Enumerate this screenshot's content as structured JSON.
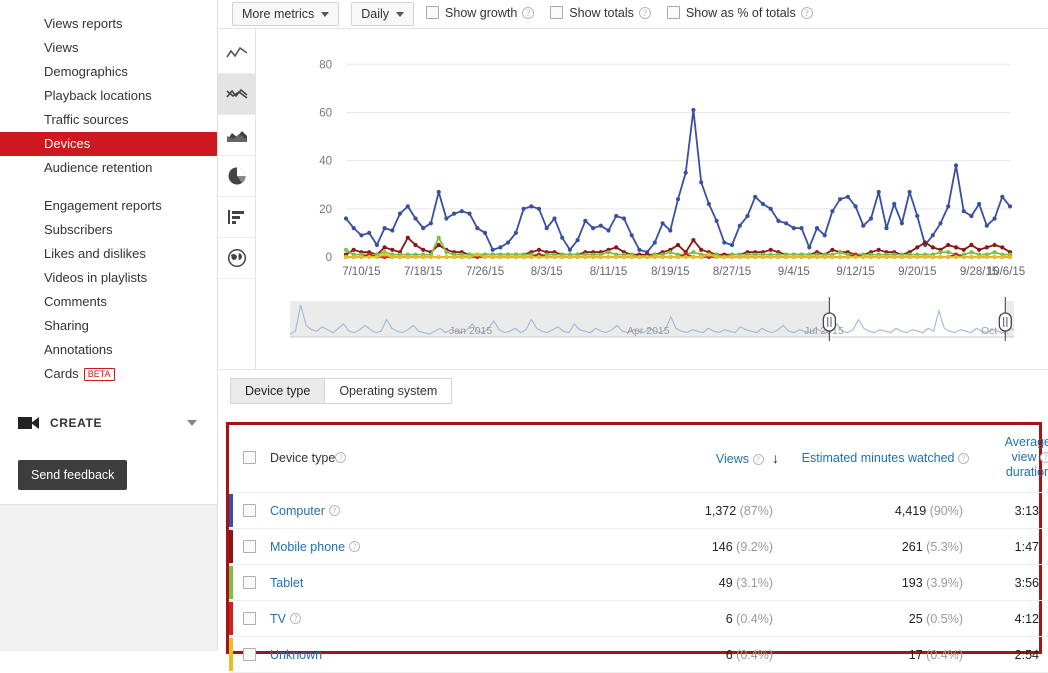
{
  "sidebar": {
    "items": [
      {
        "label": "Views reports",
        "active": false,
        "badge": null
      },
      {
        "label": "Views",
        "active": false,
        "badge": null
      },
      {
        "label": "Demographics",
        "active": false,
        "badge": null
      },
      {
        "label": "Playback locations",
        "active": false,
        "badge": null
      },
      {
        "label": "Traffic sources",
        "active": false,
        "badge": null
      },
      {
        "label": "Devices",
        "active": true,
        "badge": null
      },
      {
        "label": "Audience retention",
        "active": false,
        "badge": null
      },
      {
        "label": "Engagement reports",
        "active": false,
        "badge": null
      },
      {
        "label": "Subscribers",
        "active": false,
        "badge": null
      },
      {
        "label": "Likes and dislikes",
        "active": false,
        "badge": null
      },
      {
        "label": "Videos in playlists",
        "active": false,
        "badge": null
      },
      {
        "label": "Comments",
        "active": false,
        "badge": null
      },
      {
        "label": "Sharing",
        "active": false,
        "badge": null
      },
      {
        "label": "Annotations",
        "active": false,
        "badge": null
      },
      {
        "label": "Cards",
        "active": false,
        "badge": "BETA"
      }
    ],
    "gap_after_index": 6,
    "create_label": "CREATE",
    "create_icon": "video-camera-icon",
    "create_chevron_icon": "chevron-down-icon",
    "feedback_label": "Send feedback"
  },
  "toolbar": {
    "more_metrics_label": "More metrics",
    "period_label": "Daily",
    "checkboxes": [
      {
        "label": "Show growth",
        "checked": false
      },
      {
        "label": "Show totals",
        "checked": false
      },
      {
        "label": "Show as % of totals",
        "checked": false
      }
    ],
    "help_glyph": "?"
  },
  "chart_types": [
    {
      "name": "line-chart-icon",
      "active": false
    },
    {
      "name": "multi-line-chart-icon",
      "active": true
    },
    {
      "name": "area-chart-icon",
      "active": false
    },
    {
      "name": "pie-chart-icon",
      "active": false
    },
    {
      "name": "bar-chart-icon",
      "active": false
    },
    {
      "name": "geo-map-icon",
      "active": false
    }
  ],
  "range_selector": {
    "labels": [
      "Jan 2015",
      "Apr 2015",
      "Jul 2015",
      "Oct ..."
    ],
    "left_handle_pct": 74.5,
    "right_handle_pct": 98.8
  },
  "tabs": [
    {
      "label": "Device type",
      "active": true
    },
    {
      "label": "Operating system",
      "active": false
    }
  ],
  "table": {
    "headers": {
      "name": "Device type",
      "views": "Views",
      "minutes": "Estimated minutes watched",
      "avd_line1": "Average",
      "avd_line2": "view",
      "avd_line3": "duration"
    },
    "sort_arrow": "↓",
    "rows": [
      {
        "name": "Computer",
        "color": "#3a4fa0",
        "views": "1,372",
        "views_pct": "(87%)",
        "minutes": "4,419",
        "minutes_pct": "(90%)",
        "avd": "3:13",
        "has_help": true
      },
      {
        "name": "Mobile phone",
        "color": "#8c1616",
        "views": "146",
        "views_pct": "(9.2%)",
        "minutes": "261",
        "minutes_pct": "(5.3%)",
        "avd": "1:47",
        "has_help": true
      },
      {
        "name": "Tablet",
        "color": "#7cc043",
        "views": "49",
        "views_pct": "(3.1%)",
        "minutes": "193",
        "minutes_pct": "(3.9%)",
        "avd": "3:56",
        "has_help": false
      },
      {
        "name": "TV",
        "color": "#cc2222",
        "views": "6",
        "views_pct": "(0.4%)",
        "minutes": "25",
        "minutes_pct": "(0.5%)",
        "avd": "4:12",
        "has_help": true
      },
      {
        "name": "Unknown",
        "color": "#e8c020",
        "views": "6",
        "views_pct": "(0.4%)",
        "minutes": "17",
        "minutes_pct": "(0.4%)",
        "avd": "2:54",
        "has_help": false
      }
    ]
  },
  "chart_data": {
    "type": "line",
    "title": "",
    "xlabel": "",
    "ylabel": "",
    "ylim": [
      0,
      88
    ],
    "yticks": [
      0,
      20,
      40,
      60,
      80
    ],
    "grid": true,
    "legend_position": "none",
    "x_tick_labels": [
      "7/10/15",
      "7/18/15",
      "7/26/15",
      "8/3/15",
      "8/11/15",
      "8/19/15",
      "8/27/15",
      "9/4/15",
      "9/12/15",
      "9/20/15",
      "9/28/15",
      "10/6/15"
    ],
    "x_tick_step_days": 8,
    "x_start": "7/8/15",
    "x_end": "10/8/15",
    "series": [
      {
        "name": "Computer",
        "color": "#3a4fa0",
        "values": [
          16,
          12,
          9,
          10,
          5,
          12,
          11,
          18,
          21,
          16,
          12,
          14,
          27,
          16,
          18,
          19,
          18,
          12,
          10,
          3,
          4,
          6,
          10,
          20,
          21,
          20,
          12,
          16,
          8,
          3,
          7,
          15,
          12,
          13,
          11,
          17,
          16,
          9,
          3,
          2,
          6,
          14,
          11,
          24,
          35,
          61,
          31,
          22,
          15,
          6,
          5,
          13,
          17,
          25,
          22,
          20,
          15,
          14,
          12,
          12,
          4,
          12,
          9,
          19,
          24,
          25,
          21,
          13,
          16,
          27,
          12,
          22,
          14,
          27,
          17,
          5,
          9,
          14,
          21,
          38,
          19,
          17,
          22,
          13,
          16,
          25,
          21
        ]
      },
      {
        "name": "Mobile phone",
        "color": "#8c1616",
        "values": [
          1,
          3,
          2,
          2,
          1,
          4,
          3,
          2,
          8,
          5,
          3,
          2,
          5,
          3,
          2,
          2,
          1,
          1,
          1,
          1,
          1,
          1,
          1,
          1,
          2,
          3,
          2,
          2,
          1,
          1,
          1,
          2,
          2,
          2,
          3,
          4,
          2,
          1,
          1,
          1,
          1,
          2,
          3,
          5,
          2,
          7,
          3,
          2,
          1,
          1,
          1,
          1,
          2,
          2,
          2,
          3,
          2,
          1,
          1,
          1,
          1,
          2,
          1,
          3,
          2,
          2,
          1,
          1,
          2,
          3,
          2,
          2,
          1,
          2,
          4,
          6,
          4,
          3,
          5,
          4,
          3,
          5,
          3,
          4,
          5,
          4,
          2
        ]
      },
      {
        "name": "Tablet",
        "color": "#7cc043",
        "values": [
          3,
          1,
          1,
          1,
          1,
          2,
          1,
          1,
          1,
          1,
          1,
          1,
          8,
          2,
          1,
          1,
          1,
          1,
          1,
          1,
          1,
          1,
          1,
          1,
          1,
          1,
          1,
          1,
          1,
          1,
          1,
          1,
          1,
          1,
          2,
          1,
          1,
          1,
          0,
          0,
          1,
          1,
          2,
          1,
          1,
          2,
          1,
          1,
          1,
          0,
          1,
          1,
          1,
          1,
          1,
          1,
          1,
          1,
          1,
          1,
          1,
          1,
          1,
          1,
          2,
          1,
          1,
          1,
          1,
          1,
          1,
          1,
          1,
          1,
          1,
          1,
          1,
          2,
          2,
          1,
          1,
          2,
          1,
          1,
          2,
          1,
          1
        ]
      },
      {
        "name": "TV",
        "color": "#cc2222",
        "values": [
          0,
          0,
          0,
          1,
          0,
          0,
          0,
          0,
          0,
          0,
          0,
          0,
          0,
          0,
          0,
          0,
          0,
          0,
          0,
          0,
          0,
          0,
          0,
          0,
          0,
          1,
          0,
          0,
          0,
          0,
          0,
          0,
          0,
          0,
          0,
          0,
          0,
          0,
          0,
          0,
          0,
          0,
          0,
          0,
          1,
          0,
          0,
          0,
          0,
          0,
          0,
          0,
          0,
          0,
          0,
          0,
          0,
          0,
          0,
          0,
          0,
          0,
          0,
          0,
          0,
          0,
          1,
          0,
          0,
          0,
          0,
          0,
          0,
          0,
          0,
          0,
          0,
          0,
          0,
          1,
          0,
          0,
          0,
          0,
          0,
          0,
          0
        ]
      },
      {
        "name": "Unknown",
        "color": "#e8c020",
        "values": [
          0,
          0,
          0,
          0,
          0,
          1,
          0,
          0,
          0,
          0,
          0,
          0,
          0,
          0,
          0,
          0,
          0,
          1,
          0,
          0,
          0,
          0,
          0,
          0,
          0,
          0,
          0,
          0,
          0,
          0,
          0,
          0,
          0,
          0,
          0,
          0,
          0,
          0,
          0,
          0,
          0,
          0,
          0,
          0,
          0,
          0,
          0,
          1,
          0,
          0,
          0,
          0,
          0,
          0,
          0,
          0,
          0,
          0,
          0,
          0,
          0,
          0,
          0,
          0,
          0,
          0,
          0,
          0,
          0,
          0,
          0,
          0,
          0,
          0,
          0,
          0,
          0,
          0,
          0,
          0,
          0,
          0,
          0,
          0,
          0,
          0,
          0
        ]
      }
    ],
    "range_overview": {
      "type": "area",
      "color": "#9fb8d8",
      "values": [
        2,
        4,
        22,
        8,
        5,
        4,
        7,
        5,
        3,
        6,
        9,
        4,
        3,
        5,
        8,
        5,
        3,
        4,
        12,
        6,
        4,
        3,
        5,
        8,
        4,
        3,
        2,
        4,
        6,
        3,
        5,
        4,
        3,
        5,
        9,
        4,
        3,
        6,
        11,
        5,
        3,
        4,
        6,
        3,
        5,
        12,
        6,
        4,
        3,
        5,
        7,
        4,
        3,
        9,
        5,
        4,
        3,
        6,
        4,
        3,
        5,
        8,
        4,
        3,
        5,
        4,
        3,
        6,
        4,
        3,
        5,
        14,
        6,
        4,
        3,
        5,
        4,
        3,
        6,
        4,
        3,
        5,
        4,
        3,
        7,
        5,
        4,
        3,
        6,
        4,
        3,
        5,
        8,
        4,
        3,
        5,
        4,
        3,
        6,
        4,
        3,
        5,
        9,
        4,
        3,
        5,
        12,
        6,
        4,
        3,
        5,
        4,
        3,
        6,
        4,
        3,
        5,
        4,
        3,
        6,
        4,
        18,
        6,
        4,
        3,
        5,
        4,
        3,
        6,
        4,
        3,
        5,
        4,
        3,
        6,
        5
      ]
    }
  }
}
